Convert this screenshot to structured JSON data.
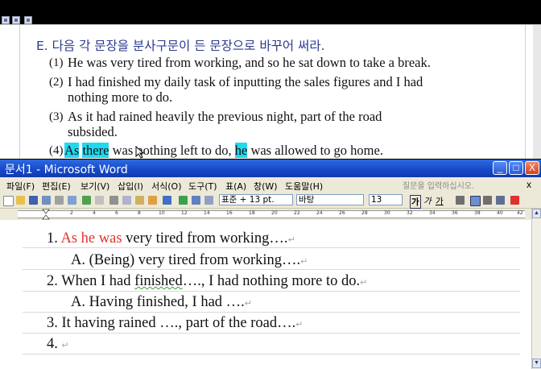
{
  "upper_doc": {
    "section_title": "E. 다음 각 문장을 분사구문이 든 문장으로 바꾸어 써라.",
    "items": [
      {
        "num": "(1)",
        "lines": [
          "He was very tired from working, and so he sat down to take a break."
        ]
      },
      {
        "num": "(2)",
        "lines": [
          "I had finished my daily task of inputting the sales figures and I had",
          "nothing more to do."
        ]
      },
      {
        "num": "(3)",
        "lines": [
          "As it had rained heavily the previous night, part of the road",
          "subsided."
        ]
      },
      {
        "num": "(4)",
        "seg": [
          "As",
          "there",
          " was nothing left to do, ",
          "he",
          " was allowed to go home."
        ]
      }
    ]
  },
  "word_window": {
    "title": "문서1 - Microsoft Word",
    "buttons": {
      "minimize": "_",
      "maximize": "□",
      "close": "X"
    },
    "menu": [
      "파일(F)",
      "편집(E)",
      "보기(V)",
      "삽입(I)",
      "서식(O)",
      "도구(T)",
      "표(A)",
      "창(W)",
      "도움말(H)"
    ],
    "help_placeholder": "질문을 입력하십시오.",
    "menu_close": "x",
    "toolbar": {
      "style": "표준 + 13 pt.",
      "font": "바탕",
      "size": "13",
      "bold": "가",
      "italic": "가",
      "underline": "가"
    },
    "ruler_numbers": [
      "2",
      "4",
      "6",
      "8",
      "10",
      "12",
      "14",
      "16",
      "18",
      "20",
      "22",
      "24",
      "26",
      "28",
      "30",
      "32",
      "34",
      "36",
      "38",
      "40",
      "42"
    ],
    "doc_lines": [
      {
        "red": "1. ",
        "redpart": "As he was",
        "rest": " very tired from working….",
        "mark": "↵"
      },
      {
        "text": "A. (Being) very tired from working….",
        "mark": "↵"
      },
      {
        "pre": "2. When I had   ",
        "squig": "finished",
        "rest": "…., I had nothing more to do.",
        "mark": "↵"
      },
      {
        "text": "A. Having finished, I had ….",
        "mark": "↵"
      },
      {
        "text": "3. It having rained …., part of the road….",
        "mark": "↵"
      },
      {
        "text": "4. ",
        "mark": "↵"
      }
    ]
  },
  "colors": {
    "highlight": "#22d8ee",
    "red_text": "#e0322a",
    "title_bar": "#1548c8"
  }
}
